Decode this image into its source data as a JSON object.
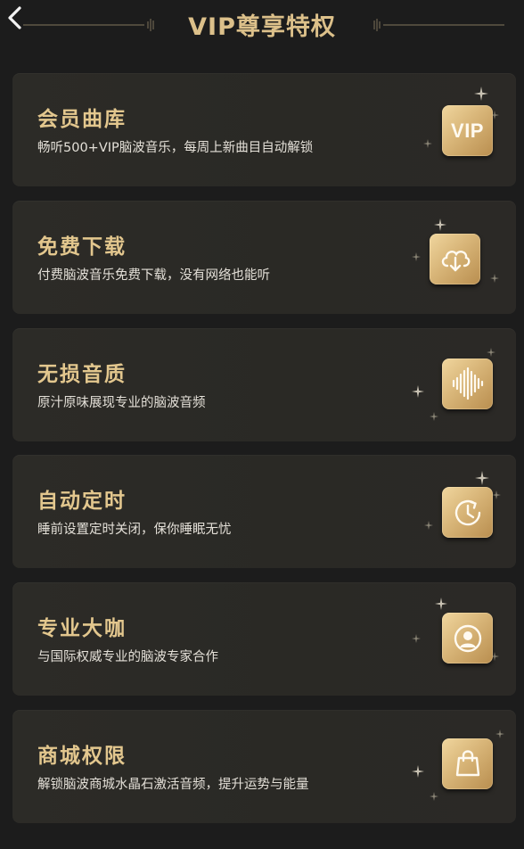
{
  "header": {
    "back_icon": "chevron-left-icon",
    "title": "VIP尊享特权"
  },
  "colors": {
    "background": "#1c1c1c",
    "card": "#2b2a26",
    "gold": "#e3c78e",
    "badge_light": "#f0d69e",
    "badge_dark": "#b98e4f",
    "desc_text": "#e4e0d8"
  },
  "privileges": [
    {
      "title": "会员曲库",
      "desc": "畅听500+VIP脑波音乐，每周上新曲目自动解锁",
      "icon": "vip-icon",
      "badge_text": "VIP"
    },
    {
      "title": "免费下载",
      "desc": "付费脑波音乐免费下载，没有网络也能听",
      "icon": "cloud-download-icon"
    },
    {
      "title": "无损音质",
      "desc": "原汁原味展现专业的脑波音频",
      "icon": "sound-wave-icon"
    },
    {
      "title": "自动定时",
      "desc": "睡前设置定时关闭，保你睡眠无忧",
      "icon": "timer-icon"
    },
    {
      "title": "专业大咖",
      "desc": "与国际权威专业的脑波专家合作",
      "icon": "expert-avatar-icon"
    },
    {
      "title": "商城权限",
      "desc": "解锁脑波商城水晶石激活音频，提升运势与能量",
      "icon": "shopping-bag-icon"
    }
  ]
}
